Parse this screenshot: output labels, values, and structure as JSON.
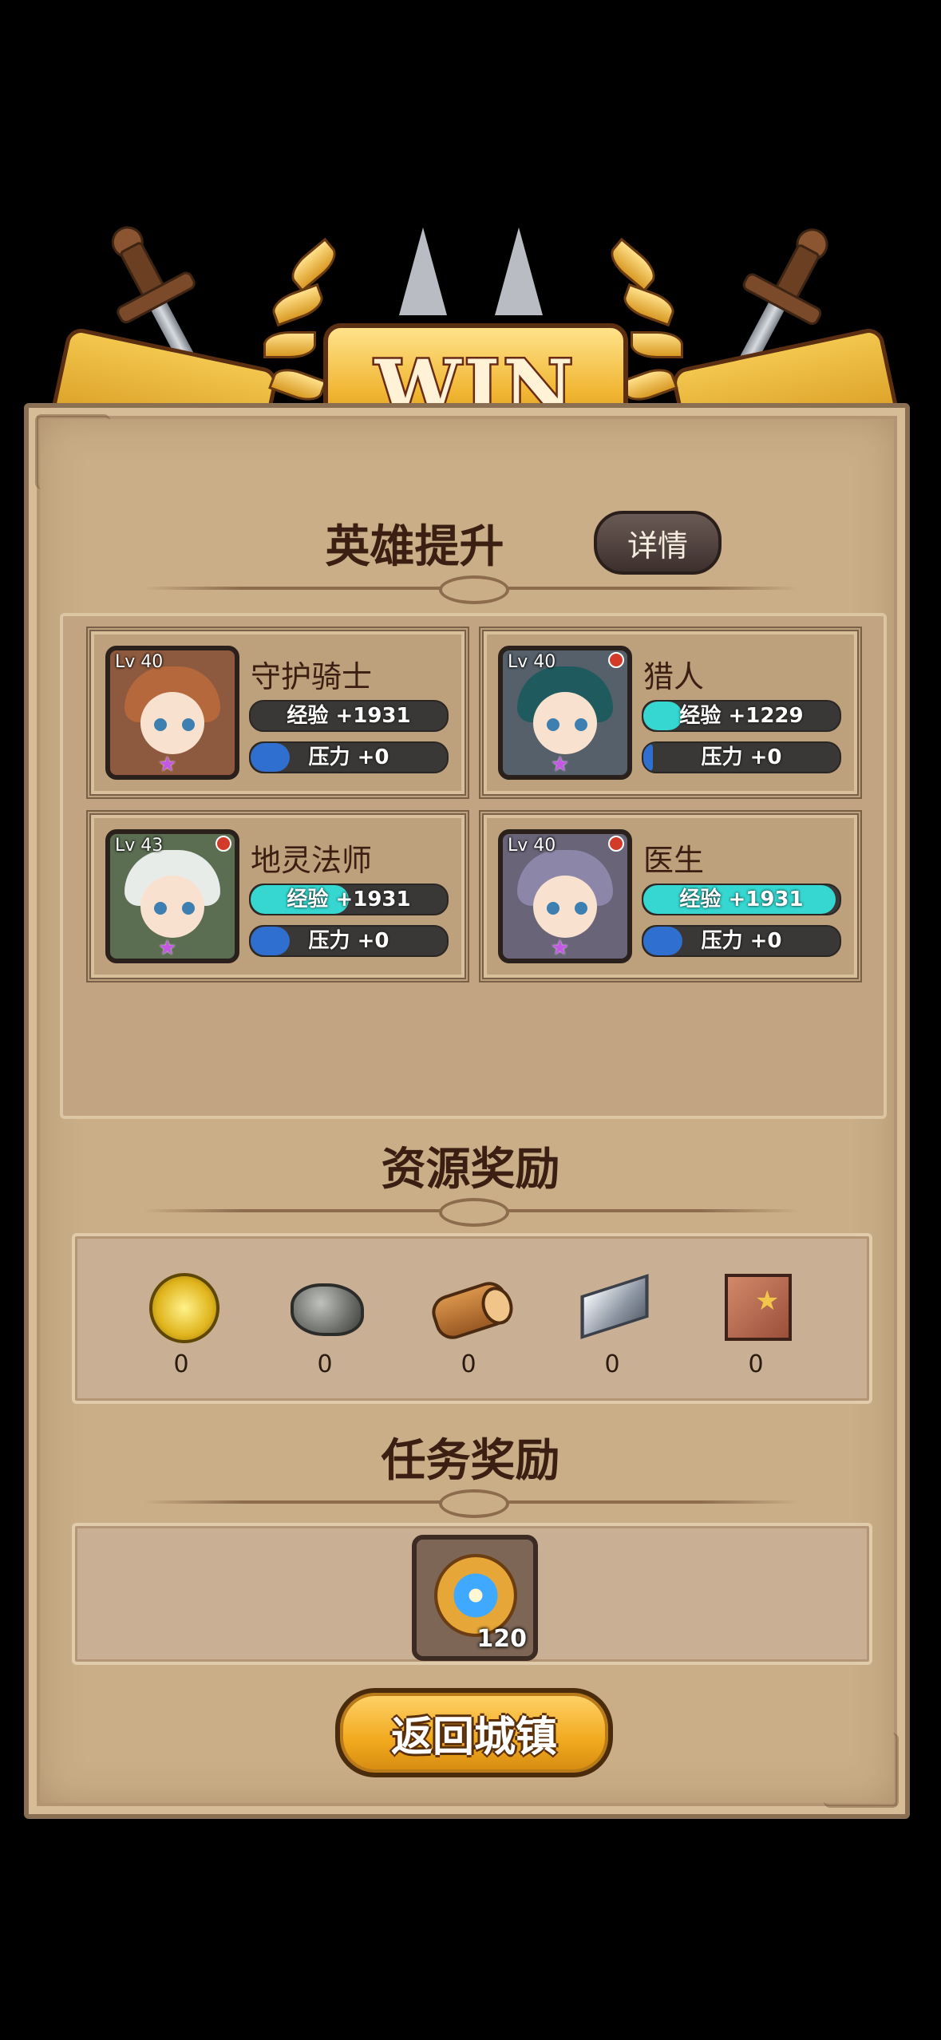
{
  "banner": {
    "title": "WIN"
  },
  "hero_section": {
    "title": "英雄提升",
    "details_label": "详情",
    "heroes": [
      {
        "name": "守护骑士",
        "level": "Lv 40",
        "exp_text": "经验 +1931",
        "exp_fill": 0,
        "stress_text": "压力 +0",
        "stress_fill": 0.2,
        "red_dot": false,
        "hair": "#b5683c",
        "bg": "#8e5a3f"
      },
      {
        "name": "猎人",
        "level": "Lv 40",
        "exp_text": "经验 +1229",
        "exp_fill": 0.2,
        "stress_text": "压力 +0",
        "stress_fill": 0.05,
        "red_dot": true,
        "hair": "#1f5a5e",
        "bg": "#55606a"
      },
      {
        "name": "地灵法师",
        "level": "Lv 43",
        "exp_text": "经验 +1931",
        "exp_fill": 0.5,
        "stress_text": "压力 +0",
        "stress_fill": 0.2,
        "red_dot": true,
        "hair": "#e8ece8",
        "bg": "#5c6e52"
      },
      {
        "name": "医生",
        "level": "Lv 40",
        "exp_text": "经验 +1931",
        "exp_fill": 0.98,
        "stress_text": "压力 +0",
        "stress_fill": 0.2,
        "red_dot": true,
        "hair": "#8c86a8",
        "bg": "#6a6478"
      }
    ]
  },
  "resource_section": {
    "title": "资源奖励",
    "items": [
      {
        "icon": "gold-coin-icon",
        "value": "0"
      },
      {
        "icon": "stone-icon",
        "value": "0"
      },
      {
        "icon": "wood-log-icon",
        "value": "0"
      },
      {
        "icon": "iron-ingot-icon",
        "value": "0"
      },
      {
        "icon": "leather-hide-icon",
        "value": "0"
      }
    ]
  },
  "quest_section": {
    "title": "任务奖励",
    "reward": {
      "icon": "medal-icon",
      "count": "120"
    }
  },
  "return_button": "返回城镇",
  "colors": {
    "exp": "#35d7d0",
    "stress": "#2f6fd0",
    "parchment": "#c9ae88",
    "gold": "#f0b531"
  }
}
